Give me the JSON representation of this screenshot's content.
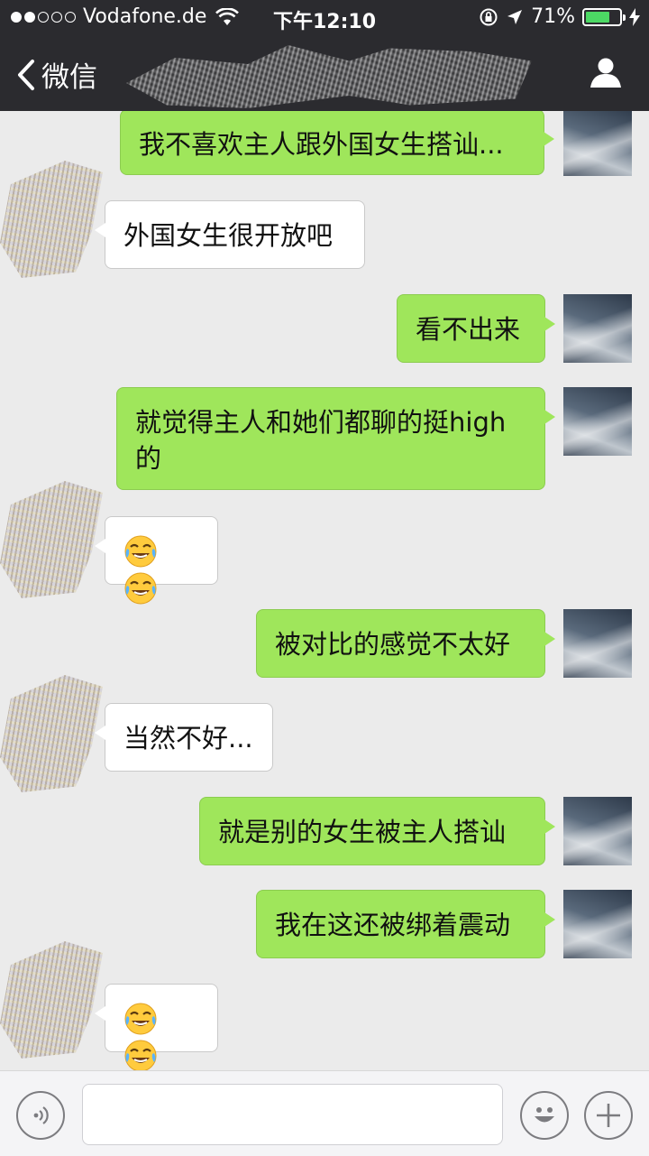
{
  "status_bar": {
    "carrier": "Vodafone.de",
    "time": "下午12:10",
    "battery": "71%",
    "battery_level": 0.71
  },
  "nav": {
    "back_label": "微信"
  },
  "messages": [
    {
      "side": "out",
      "text": "我不喜欢主人跟外国女生搭讪..."
    },
    {
      "side": "in",
      "text": "外国女生很开放吧"
    },
    {
      "side": "out",
      "text": "看不出来"
    },
    {
      "side": "out",
      "text": "就觉得主人和她们都聊的挺high的"
    },
    {
      "side": "in",
      "text": "😂😂"
    },
    {
      "side": "out",
      "text": "被对比的感觉不太好"
    },
    {
      "side": "in",
      "text": "当然不好..."
    },
    {
      "side": "out",
      "text": "就是别的女生被主人搭讪"
    },
    {
      "side": "out",
      "text": "我在这还被绑着震动"
    },
    {
      "side": "in",
      "text": "😂😂"
    }
  ],
  "input": {
    "value": ""
  },
  "colors": {
    "nav_bg": "#2b2b2f",
    "bubble_out": "#9fe65b",
    "bubble_in": "#ffffff",
    "chat_bg": "#ebebeb",
    "battery_fill": "#4cd964"
  }
}
